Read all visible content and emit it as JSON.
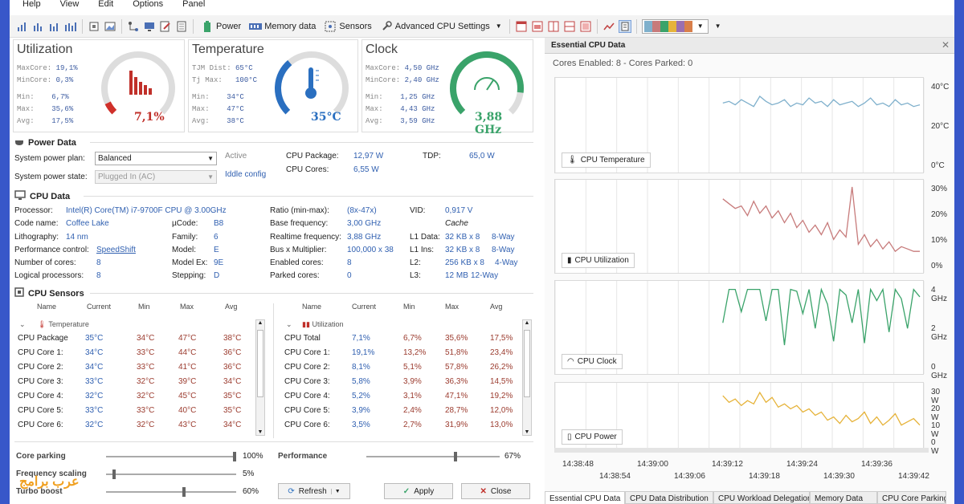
{
  "menu": [
    "Help",
    "View",
    "Edit",
    "Options",
    "Panel"
  ],
  "toolbar": {
    "power": "Power",
    "memory": "Memory data",
    "sensors": "Sensors",
    "advanced": "Advanced CPU Settings"
  },
  "gauges": {
    "util": {
      "title": "Utilization",
      "stats": [
        [
          "MaxCore:",
          "19,1%"
        ],
        [
          "MinCore:",
          "0,3%"
        ],
        [
          "Min:",
          "6,7%"
        ],
        [
          "Max:",
          "35,6%"
        ],
        [
          "Avg:",
          "17,5%"
        ]
      ],
      "value": "7,1%",
      "level": 0.071
    },
    "temp": {
      "title": "Temperature",
      "stats": [
        [
          "TJM Dist:",
          "65°C"
        ],
        [
          "Tj Max:",
          "100°C"
        ],
        [
          "Min:",
          "34°C"
        ],
        [
          "Max:",
          "47°C"
        ],
        [
          "Avg:",
          "38°C"
        ]
      ],
      "value": "35°C",
      "level": 0.35
    },
    "clock": {
      "title": "Clock",
      "stats": [
        [
          "MaxCore:",
          "4,50 GHz"
        ],
        [
          "MinCore:",
          "2,40 GHz"
        ],
        [
          "Min:",
          "1,25 GHz"
        ],
        [
          "Max:",
          "4,43 GHz"
        ],
        [
          "Avg:",
          "3,59 GHz"
        ]
      ],
      "value": "3,88 GHz",
      "level": 0.86
    }
  },
  "power": {
    "title": "Power Data",
    "plan_label": "System power plan:",
    "plan_value": "Balanced",
    "state_label": "System power state:",
    "state_value": "Plugged In (AC)",
    "active": "Active",
    "iddle": "Iddle config",
    "pkg_label": "CPU Package:",
    "pkg_value": "12,97 W",
    "cores_label": "CPU Cores:",
    "cores_value": "6,55 W",
    "tdp_label": "TDP:",
    "tdp_value": "65,0 W"
  },
  "cpu": {
    "title": "CPU Data",
    "processor_label": "Processor:",
    "processor": "Intel(R) Core(TM) i7-9700F CPU @ 3.00GHz",
    "codename_label": "Code name:",
    "codename": "Coffee Lake",
    "litho_label": "Lithography:",
    "litho": "14 nm",
    "perf_label": "Performance control:",
    "perf": "SpeedShift",
    "ncores_label": "Number of cores:",
    "ncores": "8",
    "logical_label": "Logical processors:",
    "logical": "8",
    "ucode_label": "µCode:",
    "ucode": "B8",
    "family_label": "Family:",
    "family": "6",
    "model_label": "Model:",
    "model": "E",
    "modelex_label": "Model Ex:",
    "modelex": "9E",
    "stepping_label": "Stepping:",
    "stepping": "D",
    "ratio_label": "Ratio (min-max):",
    "ratio": "(8x-47x)",
    "basefreq_label": "Base frequency:",
    "basefreq": "3,00 GHz",
    "realtime_label": "Realtime frequency:",
    "realtime": "3,88 GHz",
    "bus_label": "Bus x Multiplier:",
    "bus": "100,000 x 38",
    "enabled_label": "Enabled cores:",
    "enabled": "8",
    "parked_label": "Parked cores:",
    "parked": "0",
    "vid_label": "VID:",
    "vid": "0,917 V",
    "cache": "Cache",
    "l1d_label": "L1 Data:",
    "l1d": "32 KB x 8",
    "l1d_way": "8-Way",
    "l1i_label": "L1 Ins:",
    "l1i": "32 KB x 8",
    "l1i_way": "8-Way",
    "l2_label": "L2:",
    "l2": "256 KB x 8",
    "l2_way": "4-Way",
    "l3_label": "L3:",
    "l3": "12 MB",
    "l3_way": "12-Way"
  },
  "sensors": {
    "title": "CPU Sensors",
    "headers": [
      "Name",
      "Current",
      "Min",
      "Max",
      "Avg"
    ],
    "temp_group": "Temperature",
    "temp_rows": [
      [
        "CPU Package",
        "35°C",
        "34°C",
        "47°C",
        "38°C"
      ],
      [
        "CPU Core 1:",
        "34°C",
        "33°C",
        "44°C",
        "36°C"
      ],
      [
        "CPU Core 2:",
        "34°C",
        "33°C",
        "41°C",
        "36°C"
      ],
      [
        "CPU Core 3:",
        "33°C",
        "32°C",
        "39°C",
        "34°C"
      ],
      [
        "CPU Core 4:",
        "32°C",
        "32°C",
        "45°C",
        "35°C"
      ],
      [
        "CPU Core 5:",
        "33°C",
        "33°C",
        "40°C",
        "35°C"
      ],
      [
        "CPU Core 6:",
        "32°C",
        "32°C",
        "43°C",
        "34°C"
      ]
    ],
    "util_group": "Utilization",
    "util_rows": [
      [
        "CPU Total",
        "7,1%",
        "6,7%",
        "35,6%",
        "17,5%"
      ],
      [
        "CPU Core 1:",
        "19,1%",
        "13,2%",
        "51,8%",
        "23,4%"
      ],
      [
        "CPU Core 2:",
        "8,1%",
        "5,1%",
        "57,8%",
        "26,2%"
      ],
      [
        "CPU Core 3:",
        "5,8%",
        "3,9%",
        "36,3%",
        "14,5%"
      ],
      [
        "CPU Core 4:",
        "5,2%",
        "3,1%",
        "47,1%",
        "19,2%"
      ],
      [
        "CPU Core 5:",
        "3,9%",
        "2,4%",
        "28,7%",
        "12,0%"
      ],
      [
        "CPU Core 6:",
        "3,5%",
        "2,7%",
        "31,9%",
        "13,0%"
      ]
    ]
  },
  "bottom": {
    "parking_label": "Core parking",
    "parking_value": "100%",
    "parking_level": 1.0,
    "freq_label": "Frequency scaling",
    "freq_value": "5%",
    "freq_level": 0.05,
    "turbo_label": "Turbo boost",
    "turbo_value": "60%",
    "turbo_level": 0.6,
    "perf_label": "Performance",
    "perf_value": "67%",
    "perf_level": 0.67,
    "refresh": "Refresh",
    "apply": "Apply",
    "close": "Close"
  },
  "right": {
    "title": "Essential CPU Data",
    "cores_info": "Cores Enabled: 8 - Cores Parked: 0",
    "tabs": [
      "Essential CPU Data",
      "CPU Data Distribution",
      "CPU Workload Delegation",
      "Memory Data",
      "CPU Core Parking"
    ],
    "x_ticks_top": [
      "14:38:48",
      "14:39:00",
      "14:39:12",
      "14:39:24",
      "14:39:36"
    ],
    "x_ticks_bottom": [
      "14:38:54",
      "14:39:06",
      "14:39:18",
      "14:39:30",
      "14:39:42"
    ]
  },
  "chart_data": [
    {
      "type": "line",
      "title": "CPU Temperature",
      "y_ticks": [
        "40°C",
        "20°C",
        "0°C"
      ],
      "ylim": [
        0,
        50
      ],
      "color": "#7fb0cc",
      "values": [
        null,
        null,
        null,
        null,
        null,
        null,
        null,
        null,
        null,
        null,
        null,
        null,
        null,
        null,
        null,
        null,
        null,
        null,
        null,
        null,
        null,
        null,
        null,
        null,
        null,
        null,
        null,
        38,
        39,
        37,
        40,
        38,
        36,
        42,
        39,
        37,
        38,
        40,
        36,
        38,
        37,
        41,
        38,
        39,
        36,
        40,
        37,
        38,
        39,
        36,
        38,
        41,
        37,
        38,
        36,
        40,
        37,
        38,
        36,
        37
      ]
    },
    {
      "type": "line",
      "title": "CPU Utilization",
      "y_ticks": [
        "30%",
        "20%",
        "10%",
        "0%"
      ],
      "ylim": [
        0,
        35
      ],
      "color": "#c77b7b",
      "values": [
        null,
        null,
        null,
        null,
        null,
        null,
        null,
        null,
        null,
        null,
        null,
        null,
        null,
        null,
        null,
        null,
        null,
        null,
        null,
        null,
        null,
        null,
        null,
        null,
        null,
        null,
        null,
        29,
        27,
        25,
        26,
        22,
        28,
        23,
        26,
        21,
        24,
        19,
        23,
        17,
        20,
        15,
        18,
        14,
        19,
        12,
        16,
        13,
        34,
        10,
        14,
        9,
        12,
        8,
        11,
        7,
        9,
        8,
        7,
        7
      ]
    },
    {
      "type": "line",
      "title": "CPU Clock",
      "y_ticks": [
        "4 GHz",
        "2 GHz",
        "0 GHz"
      ],
      "ylim": [
        0,
        4.5
      ],
      "color": "#3aa36a",
      "values": [
        null,
        null,
        null,
        null,
        null,
        null,
        null,
        null,
        null,
        null,
        null,
        null,
        null,
        null,
        null,
        null,
        null,
        null,
        null,
        null,
        null,
        null,
        null,
        null,
        null,
        null,
        null,
        2.5,
        4.3,
        4.3,
        3.1,
        4.3,
        4.3,
        4.3,
        2.6,
        4.3,
        4.3,
        1.3,
        4.3,
        4.2,
        3.0,
        4.3,
        2.2,
        4.3,
        3.5,
        1.5,
        4.3,
        4.0,
        2.5,
        4.3,
        1.4,
        4.3,
        3.7,
        4.3,
        2.0,
        4.3,
        3.8,
        2.2,
        4.3,
        3.9
      ]
    },
    {
      "type": "line",
      "title": "CPU Power",
      "y_ticks": [
        "30 W",
        "20 W",
        "10 W",
        "0 W"
      ],
      "ylim": [
        0,
        35
      ],
      "color": "#e6b33a",
      "values": [
        null,
        null,
        null,
        null,
        null,
        null,
        null,
        null,
        null,
        null,
        null,
        null,
        null,
        null,
        null,
        null,
        null,
        null,
        null,
        null,
        null,
        null,
        null,
        null,
        null,
        null,
        null,
        30,
        26,
        28,
        24,
        27,
        25,
        32,
        26,
        29,
        23,
        25,
        22,
        24,
        20,
        22,
        18,
        20,
        15,
        17,
        13,
        18,
        14,
        16,
        20,
        13,
        17,
        12,
        15,
        19,
        12,
        14,
        16,
        12
      ]
    }
  ]
}
